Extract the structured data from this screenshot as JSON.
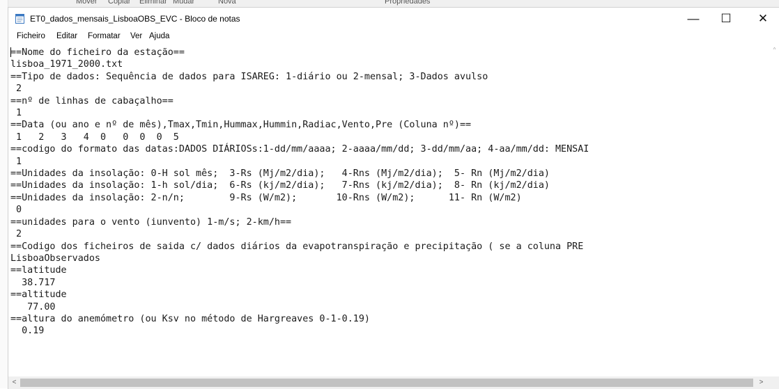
{
  "background": {
    "ribbon_labels": [
      "Mover",
      "Copiar",
      "Eliminar",
      "Mudar",
      "Nova",
      "Propriedades"
    ]
  },
  "window": {
    "title": "ET0_dados_mensais_LisboaOBS_EVC - Bloco de notas",
    "controls": {
      "minimize": "—",
      "maximize": "☐",
      "close": "✕"
    },
    "icon": "notepad-icon"
  },
  "menu": [
    "Ficheiro",
    "Editar",
    "Formatar",
    "Ver",
    "Ajuda"
  ],
  "document": {
    "lines": [
      "==Nome do ficheiro da estação==",
      "lisboa_1971_2000.txt",
      "==Tipo de dados: Sequência de dados para ISAREG: 1-diário ou 2-mensal; 3-Dados avulso",
      " 2",
      "==nº de linhas de cabaçalho==",
      " 1",
      "==Data (ou ano e nº de mês),Tmax,Tmin,Hummax,Hummin,Radiac,Vento,Pre (Coluna nº)==",
      " 1   2   3   4  0   0  0  0  5",
      "==codigo do formato das datas:DADOS DIÁRIOSs:1-dd/mm/aaaa; 2-aaaa/mm/dd; 3-dd/mm/aa; 4-aa/mm/dd: MENSAI",
      " 1",
      "==Unidades da insolação: 0-H sol mês;  3-Rs (Mj/m2/dia);   4-Rns (Mj/m2/dia);  5- Rn (Mj/m2/dia)",
      "==Unidades da insolação: 1-h sol/dia;  6-Rs (kj/m2/dia);   7-Rns (kj/m2/dia);  8- Rn (kj/m2/dia)",
      "==Unidades da insolação: 2-n/n;        9-Rs (W/m2);       10-Rns (W/m2);      11- Rn (W/m2)",
      " 0",
      "==unidades para o vento (iunvento) 1-m/s; 2-km/h==",
      " 2",
      "==Codigo dos ficheiros de saida c/ dados diários da evapotranspiração e precipitação ( se a coluna PRE",
      "LisboaObservados",
      "==latitude",
      "  38.717",
      "==altitude",
      "   77.00",
      "==altura do anemómetro (ou Ksv no método de Hargreaves 0-1-0.19)",
      "  0.19"
    ]
  },
  "scrollbars": {
    "up_arrow": "^",
    "left_arrow": "<",
    "right_arrow": ">"
  }
}
